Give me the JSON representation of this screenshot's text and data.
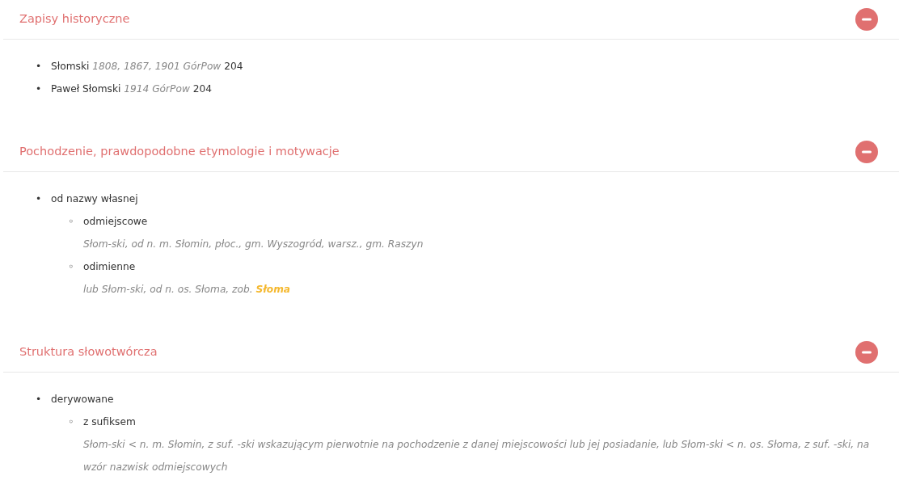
{
  "sections": [
    {
      "title": "Zapisy historyczne",
      "expanded": true,
      "kind": "records",
      "records": [
        {
          "marker": "•",
          "name": "Słomski",
          "dates": "1808, 1867, 1901 GórPow",
          "page": "204"
        },
        {
          "marker": "•",
          "name": "Paweł Słomski",
          "dates": "1914 GórPow",
          "page": "204"
        }
      ]
    },
    {
      "title": "Pochodzenie, prawdopodobne etymologie i motywacje",
      "expanded": true,
      "kind": "tree",
      "items": [
        {
          "marker": "•",
          "label": "od nazwy własnej",
          "children": [
            {
              "marker": "◦",
              "label": "odmiejscowe",
              "note": "Słom-ski, od n. m. Słomin, płoc., gm. Wyszogród, warsz., gm. Raszyn"
            },
            {
              "marker": "◦",
              "label": "odimienne",
              "note": "lub Słom-ski, od n. os. Słoma, zob.",
              "link": "Słoma"
            }
          ]
        }
      ]
    },
    {
      "title": "Struktura słowotwórcza",
      "expanded": true,
      "kind": "tree",
      "items": [
        {
          "marker": "•",
          "label": "derywowane",
          "children": [
            {
              "marker": "◦",
              "label": "z sufiksem",
              "note": "Słom-ski < n. m. Słomin, z suf. -ski wskazującym pierwotnie na pochodzenie z danej miejscowości lub jej posiadanie, lub Słom-ski < n. os. Słoma, z suf. -ski, na wzór nazwisk odmiejscowych"
            }
          ]
        }
      ]
    }
  ]
}
